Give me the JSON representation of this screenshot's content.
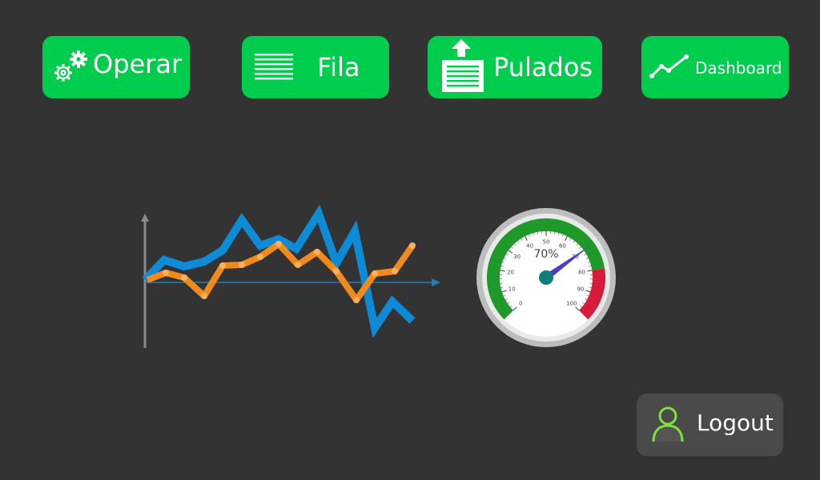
{
  "nav": {
    "operar_label": "Operar",
    "fila_label": "Fila",
    "pulados_label": "Pulados",
    "dashboard_label": "Dashboard"
  },
  "gauge": {
    "value": 70,
    "value_label": "70%",
    "ticks": [
      "0",
      "10",
      "20",
      "30",
      "40",
      "50",
      "60",
      "70",
      "80",
      "90",
      "100"
    ]
  },
  "logout": {
    "label": "Logout"
  },
  "colors": {
    "background": "#333333",
    "button_green": "#00cc4e",
    "logout_bg": "#4a4a4a",
    "user_icon_green": "#7ee03a",
    "series_blue": "#0d8bd6",
    "series_orange": "#f08a1c",
    "gauge_green": "#1f9a2a",
    "gauge_red": "#d61c3a",
    "needle": "#4a3ccf",
    "needle_hub": "#0f7f7a"
  },
  "icons": {
    "operar": "gears-icon",
    "fila": "list-lines-icon",
    "pulados": "upload-document-icon",
    "dashboard": "line-chart-icon",
    "logout": "user-icon"
  }
}
